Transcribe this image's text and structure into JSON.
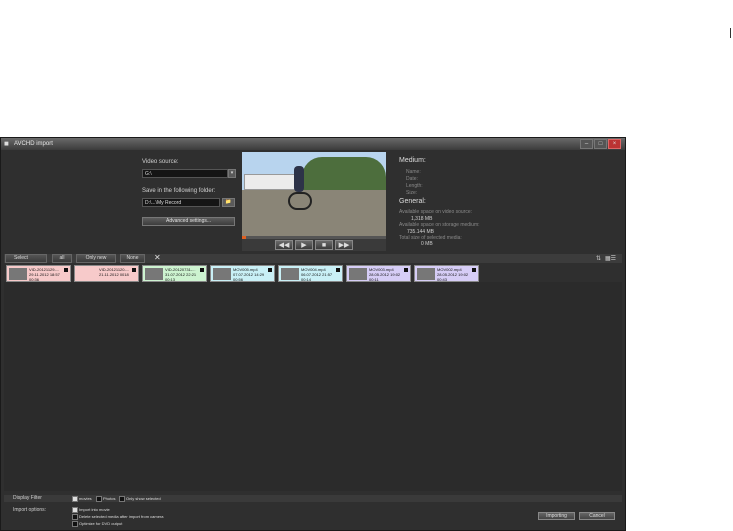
{
  "window": {
    "title": "AVCHD import"
  },
  "source": {
    "label": "Video source:",
    "value": "G:\\",
    "folder_label": "Save in the following folder:",
    "folder_value": "D:\\...\\My Record",
    "advanced_button": "Advanced settings..."
  },
  "info": {
    "medium_heading": "Medium:",
    "name_label": "Name:",
    "date_label": "Date:",
    "length_label": "Length:",
    "size_label": "Size:",
    "general_heading": "General:",
    "space_video_label": "Available space on video source:",
    "space_video_value": "1,318 MB",
    "space_storage_label": "Available space on storage medium:",
    "space_storage_value": "735.144 MB",
    "selected_label": "Total size of selected media:",
    "selected_value": "0 MB"
  },
  "toolbar": {
    "select": "Select",
    "all": "all",
    "only_new": "Only new",
    "none": "None"
  },
  "colors": {
    "pink": "#f7caca",
    "green": "#cdf3d0",
    "cyan": "#c9f0f6",
    "purple": "#d6cdf6"
  },
  "clips": [
    {
      "name": "VID-20121129-...",
      "date": "29.11.2012 18:57",
      "dur": "00:36",
      "color": "#f7caca"
    },
    {
      "name": "VID-20121120-...",
      "date": "21.11.2012 0018",
      "dur": "",
      "color": "#f7caca"
    },
    {
      "name": "VID-20120731-...",
      "date": "31.07.2012 22:21",
      "dur": "00:13",
      "color": "#cdf3d0"
    },
    {
      "name": "MOV005.mp4",
      "date": "07.07.2012 14:29",
      "dur": "00:56",
      "color": "#c9f0f6"
    },
    {
      "name": "MOV004.mp4",
      "date": "06.07.2012 21:57",
      "dur": "00:14",
      "color": "#c9f0f6"
    },
    {
      "name": "MOV003.mp4",
      "date": "28.05.2012 19:02",
      "dur": "00:11",
      "color": "#d6cdf6"
    },
    {
      "name": "MOV002.mp4",
      "date": "28.05.2012 19:02",
      "dur": "00:43",
      "color": "#d6cdf6"
    }
  ],
  "filter": {
    "label": "Display Filter",
    "movies": "movies",
    "photos": "Photos",
    "only_selected": "Only show selected"
  },
  "options": {
    "label": "Import options:",
    "opt1": "Import into movie",
    "opt2": "Delete selected media after import from camera",
    "opt3": "Optimize for DVD output"
  },
  "buttons": {
    "importing": "Importing",
    "cancel": "Cancel"
  }
}
